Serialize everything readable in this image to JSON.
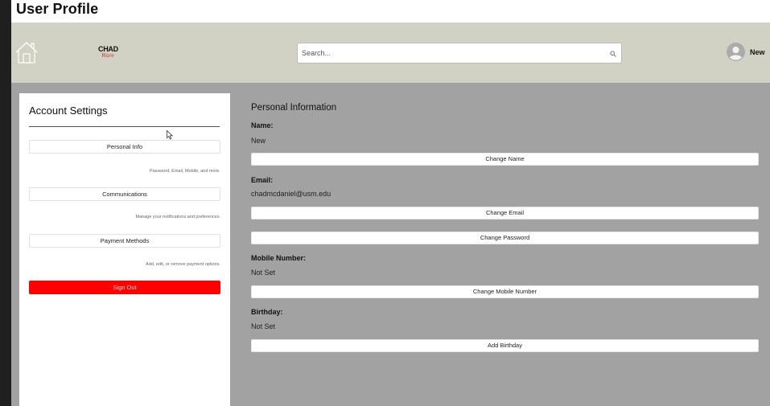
{
  "window": {
    "title": "User Profile"
  },
  "header": {
    "logo_line1": "CHAD",
    "logo_line2": "Ware",
    "search_placeholder": "Search...",
    "user_name": "New"
  },
  "sidebar": {
    "heading": "Account Settings",
    "items": [
      {
        "label": "Personal Info",
        "description": "Password, Email, Mobile, and more."
      },
      {
        "label": "Communications",
        "description": "Manage your notifications and preferences."
      },
      {
        "label": "Payment Methods",
        "description": "Add, edit, or remove payment options."
      }
    ],
    "sign_out_label": "Sign Out"
  },
  "main": {
    "title": "Personal Information",
    "name_label": "Name:",
    "name_value": "New",
    "change_name_label": "Change Name",
    "email_label": "Email:",
    "email_value": "chadmcdaniel@usm.edu",
    "change_email_label": "Change Email",
    "change_password_label": "Change Password",
    "mobile_label": "Mobile Number:",
    "mobile_value": "Not Set",
    "change_mobile_label": "Change Mobile Number",
    "birthday_label": "Birthday:",
    "birthday_value": "Not Set",
    "add_birthday_label": "Add Birthday"
  },
  "colors": {
    "header_bg": "#d2d2c4",
    "content_bg": "#a2a2a2",
    "sign_out": "#ff0000"
  },
  "icons": [
    "home-icon",
    "search-icon",
    "avatar-icon",
    "cursor-icon"
  ]
}
